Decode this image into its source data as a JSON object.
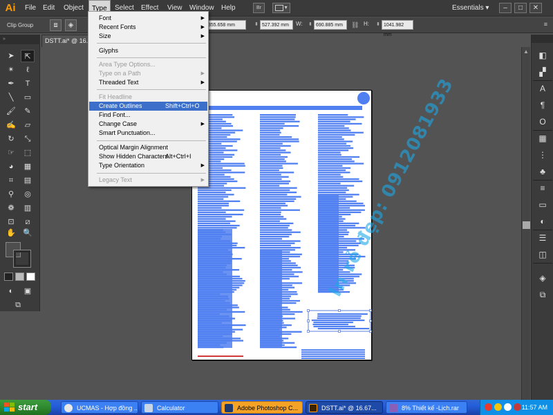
{
  "app": {
    "logo": "Ai"
  },
  "menubar": {
    "items": [
      "File",
      "Edit",
      "Object",
      "Type",
      "Select",
      "Effect",
      "View",
      "Window",
      "Help"
    ],
    "br_label": "Br",
    "workspace": "Essentials"
  },
  "window_controls": {
    "minimize": "–",
    "restore": "□",
    "close": "✕"
  },
  "controlbar": {
    "selection_label": "Clip Group",
    "x_value": "355.658 mm",
    "y_value": "527.392 mm",
    "w_label": "W:",
    "w_value": "690.885 mm",
    "h_label": "H:",
    "h_value": "1041.982 mm"
  },
  "document_tab": {
    "label": "DSTT.ai* @ 16.67"
  },
  "type_menu": {
    "items": [
      {
        "label": "Font",
        "submenu": true
      },
      {
        "label": "Recent Fonts",
        "submenu": true
      },
      {
        "label": "Size",
        "submenu": true
      },
      {
        "label": "Glyphs"
      },
      {
        "label": "Area Type Options...",
        "disabled": true
      },
      {
        "label": "Type on a Path",
        "disabled": true,
        "submenu": true
      },
      {
        "label": "Threaded Text",
        "submenu": true
      },
      {
        "label": "Fit Headline",
        "disabled": true
      },
      {
        "label": "Create Outlines",
        "shortcut": "Shift+Ctrl+O",
        "highlighted": true
      },
      {
        "label": "Find Font..."
      },
      {
        "label": "Change Case",
        "submenu": true
      },
      {
        "label": "Smart Punctuation..."
      },
      {
        "label": "Optical Margin Alignment"
      },
      {
        "label": "Show Hidden Characters",
        "shortcut": "Alt+Ctrl+I"
      },
      {
        "label": "Type Orientation",
        "submenu": true
      },
      {
        "label": "Legacy Text",
        "disabled": true,
        "submenu": true
      }
    ]
  },
  "tools": {
    "icons": [
      "selection-tool-icon",
      "direct-selection-tool-icon",
      "magic-wand-tool-icon",
      "lasso-tool-icon",
      "pen-tool-icon",
      "type-tool-icon",
      "line-tool-icon",
      "rectangle-tool-icon",
      "paintbrush-tool-icon",
      "pencil-tool-icon",
      "blob-brush-tool-icon",
      "eraser-tool-icon",
      "rotate-tool-icon",
      "scale-tool-icon",
      "warp-tool-icon",
      "free-transform-tool-icon",
      "shape-builder-tool-icon",
      "perspective-grid-tool-icon",
      "mesh-tool-icon",
      "gradient-tool-icon",
      "eyedropper-tool-icon",
      "blend-tool-icon",
      "symbol-sprayer-tool-icon",
      "column-graph-tool-icon",
      "artboard-tool-icon",
      "slice-tool-icon",
      "hand-tool-icon",
      "zoom-tool-icon"
    ]
  },
  "artboard": {
    "accent": "#4f7ff0"
  },
  "watermark": {
    "text": "In rẻ đẹp: 0912081933"
  },
  "taskbar": {
    "start_label": "start",
    "tasks": [
      {
        "label": "UCMAS - Hợp đồng ..."
      },
      {
        "label": "Calculator"
      },
      {
        "label": "Adobe Photoshop C..."
      },
      {
        "label": "DSTT.ai* @ 16.67..."
      },
      {
        "label": "8% Thiết kế -Lịch.rar"
      }
    ],
    "clock": "11:57 AM"
  },
  "colors": {
    "menubar_bg": "#3a3a3a",
    "canvas_bg": "#535353",
    "menu_highlight": "#3b6fc9",
    "ai_logo": "#ff9a00",
    "taskbar": "#245edb",
    "start_green": "#2f8a2f",
    "tray": "#0f8fe6"
  }
}
